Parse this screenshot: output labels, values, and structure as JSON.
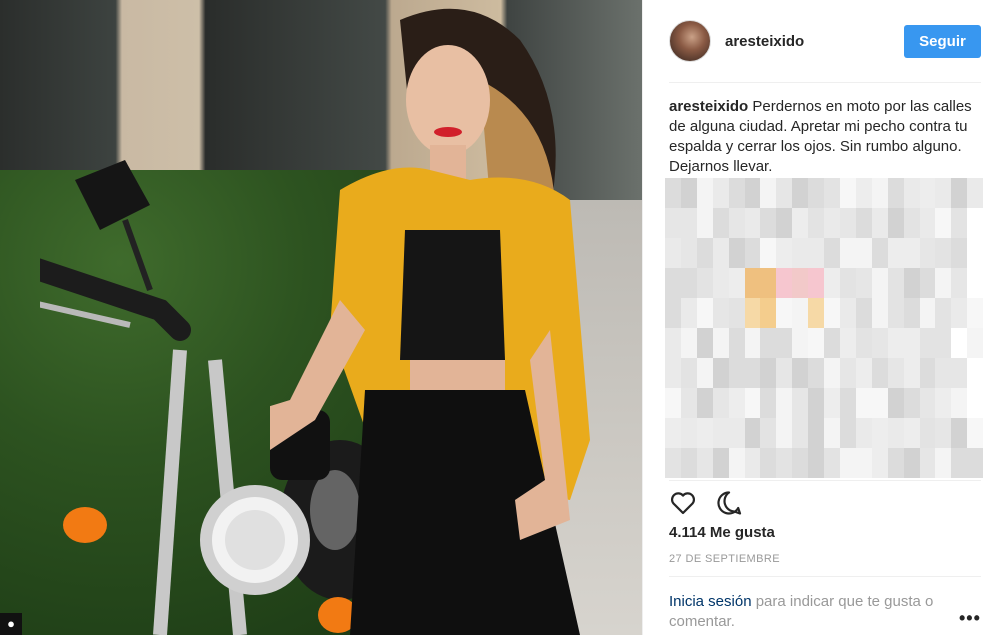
{
  "post": {
    "username": "aresteixido",
    "follow_label": "Seguir",
    "caption_user": "aresteixido",
    "caption_text": "Perdernos en moto por las calles de alguna ciudad. Apretar mi pecho contra tu espalda y cerrar los ojos. Sin rumbo alguno. Dejarnos llevar.",
    "likes": "4.114 Me gusta",
    "date": "27 DE SEPTIEMBRE",
    "login_link": "Inicia sesión",
    "login_rest": " para indicar que te gusta o comentar.",
    "more": "•••"
  },
  "icons": {
    "like": "heart-icon",
    "comment": "comment-icon",
    "user": "user-icon"
  },
  "colors": {
    "follow_button": "#3897f0",
    "link": "#003569",
    "muted": "#999999"
  }
}
